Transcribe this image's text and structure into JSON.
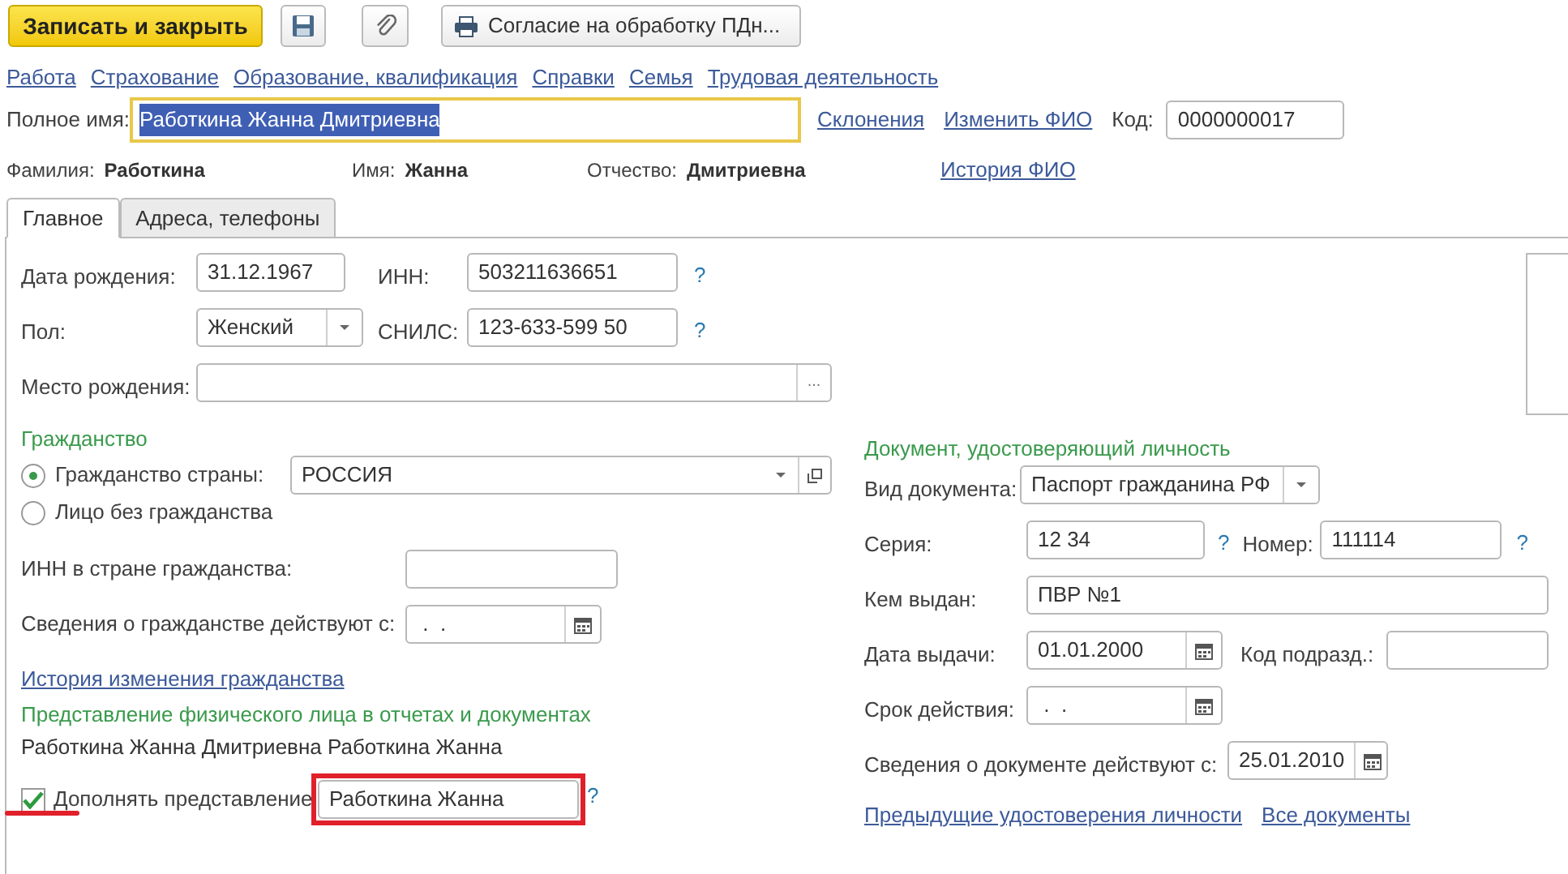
{
  "toolbar": {
    "save_close": "Записать и закрыть",
    "print": "Согласие на обработку ПДн..."
  },
  "nav_links": [
    "Работа",
    "Страхование",
    "Образование, квалификация",
    "Справки",
    "Семья",
    "Трудовая деятельность"
  ],
  "full_name": {
    "label": "Полное имя:",
    "value": "Работкина Жанна Дмитриевна",
    "text_selected": true
  },
  "name_links": [
    "Склонения",
    "Изменить ФИО"
  ],
  "code": {
    "label": "Код:",
    "value": "0000000017"
  },
  "name_parts": [
    {
      "label": "Фамилия:",
      "value": "Работкина"
    },
    {
      "label": "Имя:",
      "value": "Жанна"
    },
    {
      "label": "Отчество:",
      "value": "Дмитриевна"
    }
  ],
  "name_history_link": "История ФИО",
  "tabs": [
    {
      "label": "Главное",
      "selected": true
    },
    {
      "label": "Адреса, телефоны",
      "selected": false
    }
  ],
  "personal": {
    "birth_date": {
      "label": "Дата рождения:",
      "value": "31.12.1967"
    },
    "inn": {
      "label": "ИНН:",
      "value": "503211636651",
      "help": "?"
    },
    "gender": {
      "label": "Пол:",
      "value": "Женский"
    },
    "snils": {
      "label": "СНИЛС:",
      "value": "123-633-599 50",
      "help": "?"
    },
    "birth_place": {
      "label": "Место рождения:",
      "button": "..."
    }
  },
  "citizenship": {
    "title": "Гражданство",
    "options": [
      {
        "label": "Гражданство страны:",
        "selected": true
      },
      {
        "label": "Лицо без гражданства",
        "selected": false
      }
    ],
    "country": "РОССИЯ",
    "foreign_inn": {
      "label": "ИНН в стране гражданства:"
    },
    "valid_from": {
      "label": "Сведения о гражданстве действуют с:",
      "value": " .  ."
    },
    "history_link": "История изменения гражданства"
  },
  "presentation": {
    "title": "Представление физического лица в отчетах и документах",
    "text": "Работкина Жанна Дмитриевна Работкина Жанна",
    "supplement": {
      "label": "Дополнять представление",
      "checked": true,
      "value": "Работкина Жанна",
      "help": "?"
    }
  },
  "identity_document": {
    "title": "Документ, удостоверяющий личность",
    "type": {
      "label": "Вид документа:",
      "value": "Паспорт гражданина РФ"
    },
    "series": {
      "label": "Серия:",
      "value": "12 34",
      "help": "?"
    },
    "number": {
      "label": "Номер:",
      "value": "111114",
      "help": "?"
    },
    "issued_by": {
      "label": "Кем выдан:",
      "value": "ПВР №1"
    },
    "issue_date": {
      "label": "Дата выдачи:",
      "value": "01.01.2000"
    },
    "department_code": {
      "label": "Код подразд.:"
    },
    "expiry": {
      "label": "Срок действия:",
      "value": " .  ."
    },
    "valid_from": {
      "label": "Сведения о документе действуют с:",
      "value": "25.01.2010"
    },
    "links": [
      "Предыдущие удостоверения личности",
      "Все документы"
    ]
  }
}
